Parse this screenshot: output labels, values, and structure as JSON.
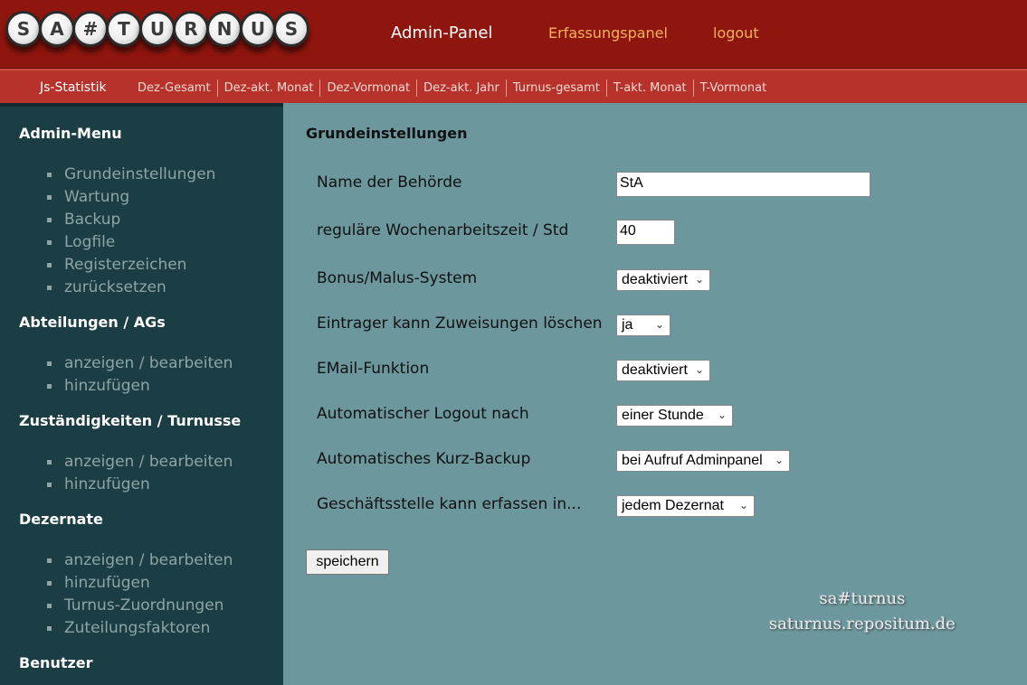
{
  "header": {
    "logo_text": "SA#TURNUS",
    "logo_letters": [
      "S",
      "A",
      "#",
      "T",
      "U",
      "R",
      "N",
      "U",
      "S"
    ],
    "nav": {
      "admin": "Admin-Panel",
      "erfassung": "Erfassungspanel",
      "logout": "logout"
    }
  },
  "subnav": {
    "title": "Js-Statistik",
    "links": [
      "Dez-Gesamt",
      "Dez-akt. Monat",
      "Dez-Vormonat",
      "Dez-akt. Jahr",
      "Turnus-gesamt",
      "T-akt. Monat",
      "T-Vormonat"
    ]
  },
  "sidebar": {
    "sections": [
      {
        "title": "Admin-Menu",
        "items": [
          "Grundeinstellungen",
          "Wartung",
          "Backup",
          "Logfile",
          "Registerzeichen",
          "zurücksetzen"
        ]
      },
      {
        "title": "Abteilungen / AGs",
        "items": [
          "anzeigen / bearbeiten",
          "hinzufügen"
        ]
      },
      {
        "title": "Zuständigkeiten / Turnusse",
        "items": [
          "anzeigen / bearbeiten",
          "hinzufügen"
        ]
      },
      {
        "title": "Dezernate",
        "items": [
          "anzeigen / bearbeiten",
          "hinzufügen",
          "Turnus-Zuordnungen",
          "Zuteilungsfaktoren"
        ]
      },
      {
        "title": "Benutzer",
        "items": []
      }
    ]
  },
  "main": {
    "title": "Grundeinstellungen",
    "fields": {
      "behoerde": {
        "label": "Name der Behörde",
        "value": "StA"
      },
      "wochenarbeitszeit": {
        "label": "reguläre Wochenarbeitszeit / Std",
        "value": "40"
      },
      "bonus": {
        "label": "Bonus/Malus-System",
        "value": "deaktiviert"
      },
      "eintrager": {
        "label": "Eintrager kann Zuweisungen löschen",
        "value": "ja"
      },
      "email": {
        "label": "EMail-Funktion",
        "value": "deaktiviert"
      },
      "logout": {
        "label": "Automatischer Logout nach",
        "value": "einer Stunde"
      },
      "backup": {
        "label": "Automatisches Kurz-Backup",
        "value": "bei Aufruf Adminpanel"
      },
      "geschaeftsstelle": {
        "label": "Geschäftsstelle kann erfassen in...",
        "value": "jedem Dezernat"
      }
    },
    "save_label": "speichern",
    "watermark": {
      "line1": "sa#turnus",
      "line2": "saturnus.repositum.de"
    }
  },
  "colors": {
    "header_bg": "#8f160e",
    "subnav_bg": "#b7322a",
    "sidebar_bg": "#1b3d44",
    "main_bg": "#6b979d",
    "accent_link": "#f3b35a"
  }
}
